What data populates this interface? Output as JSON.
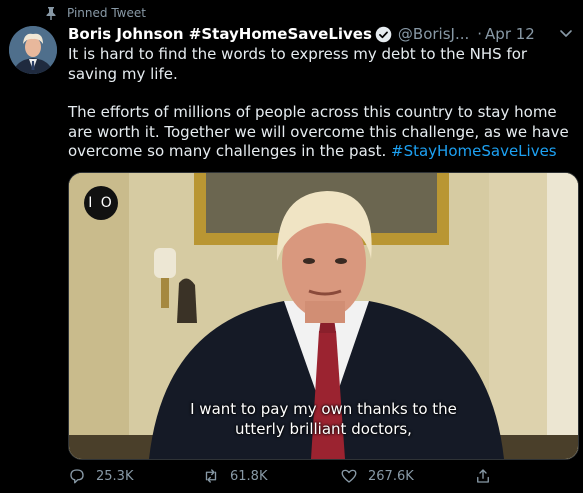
{
  "pinned": {
    "label": "Pinned Tweet"
  },
  "author": {
    "name": "Boris Johnson #StayHomeSaveLives",
    "handle": "@BorisJ...",
    "separator": "·",
    "date": "Apr 12"
  },
  "tweet": {
    "line1": "It is hard to find the words to express my debt to the NHS for saving my life.",
    "line2": "The efforts of millions of people across this country to stay home are worth it. Together we will overcome this challenge, as we have overcome so many challenges in the past.",
    "hashtag": "#StayHomeSaveLives"
  },
  "media": {
    "badge": "I O",
    "caption_line1": "I want to pay my own thanks to the",
    "caption_line2": "utterly brilliant doctors,"
  },
  "actions": {
    "replies": "25.3K",
    "retweets": "61.8K",
    "likes": "267.6K"
  },
  "colors": {
    "background": "#000000",
    "accent": "#1da1f2",
    "muted": "#8899a6"
  }
}
